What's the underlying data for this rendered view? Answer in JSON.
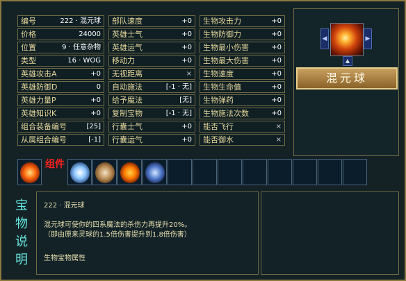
{
  "stats": [
    [
      "编号",
      "222 · 混元球"
    ],
    [
      "部队速度",
      "+0"
    ],
    [
      "生物攻击力",
      "+0"
    ],
    [
      "价格",
      "24000"
    ],
    [
      "英雄士气",
      "+0"
    ],
    [
      "生物防御力",
      "+0"
    ],
    [
      "位置",
      "9 · 任意杂物"
    ],
    [
      "英雄运气",
      "+0"
    ],
    [
      "生物最小伤害",
      "+0"
    ],
    [
      "类型",
      "16 · WOG"
    ],
    [
      "移动力",
      "+0"
    ],
    [
      "生物最大伤害",
      "+0"
    ],
    [
      "英雄攻击A",
      "+0"
    ],
    [
      "无视距离",
      "×"
    ],
    [
      "生物速度",
      "+0"
    ],
    [
      "英雄防御D",
      "0"
    ],
    [
      "自动施法",
      "[-1 · 无]"
    ],
    [
      "生物生命值",
      "+0"
    ],
    [
      "英雄力量P",
      "+0"
    ],
    [
      "给予魔法",
      "[无]"
    ],
    [
      "生物弹药",
      "+0"
    ],
    [
      "英雄知识K",
      "+0"
    ],
    [
      "复制宝物",
      "[-1 · 无]"
    ],
    [
      "生物施法次数",
      "+0"
    ],
    [
      "组合装备编号",
      "[25]"
    ],
    [
      "行囊士气",
      "+0"
    ],
    [
      "能否飞行",
      "×"
    ],
    [
      "从属组合编号",
      "[-1]"
    ],
    [
      "行囊运气",
      "+0"
    ],
    [
      "能否御水",
      "×"
    ]
  ],
  "artifact_name": "混元球",
  "zujian_label": "组件",
  "desc_title_chars": [
    "宝",
    "物",
    "说",
    "明"
  ],
  "description": {
    "header": "222 · 混元球",
    "line1": "混元球可使你的四系魔法的杀伤力再提升20%。",
    "line2": "（即由原来灵球的1.5倍伤害提升到1.8倍伤害）",
    "line3": "生物宝物属性"
  },
  "icons": {
    "prev": "left-arrow-icon",
    "next": "right-arrow-icon",
    "slot_art": [
      "fire-orb-icon",
      "water-orb-icon",
      "earth-orb-icon",
      "fire-sphere-icon",
      "air-orb-icon"
    ]
  }
}
